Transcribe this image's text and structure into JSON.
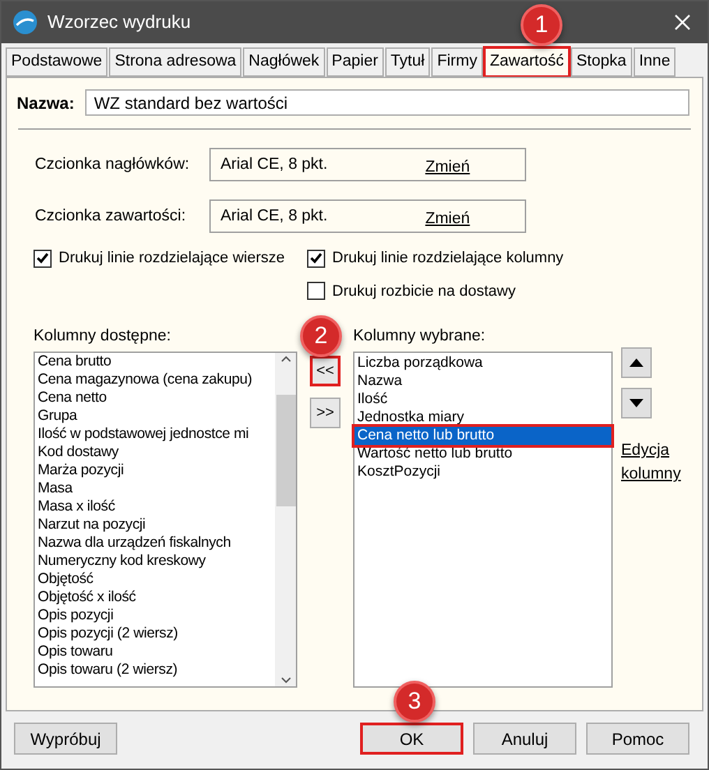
{
  "window": {
    "title": "Wzorzec wydruku"
  },
  "tabs": [
    {
      "label": "Podstawowe",
      "selected": false,
      "highlighted": false
    },
    {
      "label": "Strona adresowa",
      "selected": false,
      "highlighted": false
    },
    {
      "label": "Nagłówek",
      "selected": false,
      "highlighted": false
    },
    {
      "label": "Papier",
      "selected": false,
      "highlighted": false
    },
    {
      "label": "Tytuł",
      "selected": false,
      "highlighted": false
    },
    {
      "label": "Firmy",
      "selected": false,
      "highlighted": false
    },
    {
      "label": "Zawartość",
      "selected": true,
      "highlighted": true
    },
    {
      "label": "Stopka",
      "selected": false,
      "highlighted": false
    },
    {
      "label": "Inne",
      "selected": false,
      "highlighted": false
    }
  ],
  "name_field": {
    "label": "Nazwa:",
    "value": "WZ standard bez wartości"
  },
  "fonts": [
    {
      "label": "Czcionka nagłówków:",
      "value": "Arial CE, 8 pkt.",
      "link": "Zmień"
    },
    {
      "label": "Czcionka zawartości:",
      "value": "Arial CE, 8 pkt.",
      "link": "Zmień"
    }
  ],
  "checkboxes": [
    {
      "label": "Drukuj linie rozdzielające wiersze",
      "checked": true
    },
    {
      "label": "Drukuj linie rozdzielające kolumny",
      "checked": true
    },
    {
      "label": "Drukuj rozbicie na dostawy",
      "checked": false
    }
  ],
  "available": {
    "label": "Kolumny dostępne:",
    "items": [
      "Cena brutto",
      "Cena magazynowa (cena zakupu)",
      "Cena netto",
      "Grupa",
      "Ilość w podstawowej jednostce mi",
      "Kod dostawy",
      "Marża pozycji",
      "Masa",
      "Masa x ilość",
      "Narzut na pozycji",
      "Nazwa dla urządzeń fiskalnych",
      "Numeryczny kod kreskowy",
      "Objętość",
      "Objętość x ilość",
      "Opis pozycji",
      "Opis pozycji (2 wiersz)",
      "Opis towaru",
      "Opis towaru (2 wiersz)"
    ]
  },
  "move_buttons": [
    {
      "label": "<<",
      "highlighted": true
    },
    {
      "label": ">>",
      "highlighted": false
    }
  ],
  "selected_columns": {
    "label": "Kolumny wybrane:",
    "items": [
      {
        "label": "Liczba porządkowa",
        "selected": false,
        "highlighted": false
      },
      {
        "label": "Nazwa",
        "selected": false,
        "highlighted": false
      },
      {
        "label": "Ilość",
        "selected": false,
        "highlighted": false
      },
      {
        "label": "Jednostka miary",
        "selected": false,
        "highlighted": false
      },
      {
        "label": "Cena netto lub brutto",
        "selected": true,
        "highlighted": true
      },
      {
        "label": "Wartość netto lub brutto",
        "selected": false,
        "highlighted": false
      },
      {
        "label": "KosztPozycji",
        "selected": false,
        "highlighted": false
      }
    ]
  },
  "edit_link": "Edycja kolumny",
  "buttons": [
    {
      "label": "Wypróbuj",
      "highlighted": false
    },
    {
      "label": "OK",
      "highlighted": true
    },
    {
      "label": "Anuluj",
      "highlighted": false
    },
    {
      "label": "Pomoc",
      "highlighted": false
    }
  ],
  "annotations": [
    "1",
    "2",
    "3"
  ]
}
